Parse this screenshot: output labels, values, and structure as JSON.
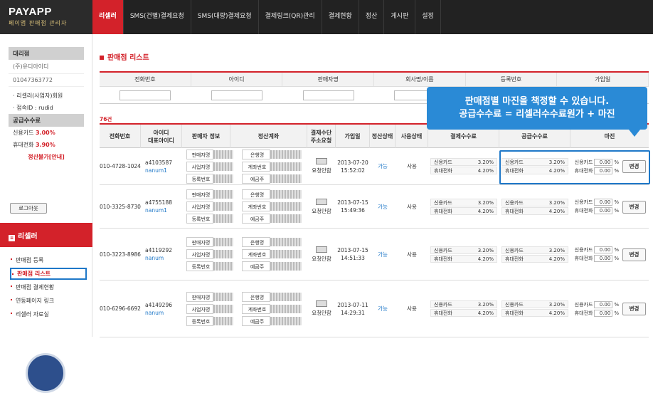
{
  "app": {
    "logo_title": "PAYAPP",
    "logo_subtitle": "페이앱 판매점 관리자"
  },
  "nav": [
    "리셀러",
    "SMS(건별)결제요청",
    "SMS(대량)결제요청",
    "결제링크(QR)관리",
    "결제현황",
    "정산",
    "게시판",
    "설정"
  ],
  "sidebar": {
    "agency_header": "대리점",
    "agency_name": "(주)유디아이디",
    "agency_phone": "01047363772",
    "member_type": "리셀러(사업자)회원",
    "login_label": "접속ID : rudid",
    "fee_header": "공급수수료",
    "card_label": "신용카드",
    "card_value": "3.00%",
    "phone_label": "휴대전화",
    "phone_value": "3.90%",
    "settle_status": "정산불가[안내]",
    "logout_label": "로그아웃",
    "section_title": "리셀러",
    "menu": [
      "판매점 등록",
      "판매점 리스트",
      "판매점 결제현황",
      "연동페이지 링크",
      "리셀러 자료실"
    ]
  },
  "main": {
    "title": "판매점 리스트",
    "search_headers": [
      "전화번호",
      "아이디",
      "판매자명",
      "회사명/이름",
      "등록번호",
      "가입일"
    ],
    "count": "76건",
    "columns": [
      "전화번호",
      "아이디\n대표아이디",
      "판매자 정보",
      "정산계좌",
      "결제수단\n주소요청",
      "가입일",
      "정산상태",
      "사용상태",
      "결제수수료",
      "공급수수료",
      "마진"
    ],
    "seller_labels": [
      "판매자명",
      "사업자명",
      "등록번호"
    ],
    "account_labels": [
      "은행명",
      "계좌번호",
      "예금주"
    ],
    "fee_labels": [
      "신용카드",
      "휴대전화"
    ],
    "change_label": "변경",
    "request_label": "요청안함",
    "rows": [
      {
        "phone": "010-4728-1024",
        "id": "a4103587",
        "rep": "nanum1",
        "joined": [
          "2013-07-20",
          "15:52:02"
        ],
        "settle": "가능",
        "use": "사용",
        "pay_card": "3.20%",
        "pay_phone": "4.20%",
        "sup_card": "3.20%",
        "sup_phone": "4.20%",
        "m_card": "0.00",
        "m_phone": "0.00"
      },
      {
        "phone": "010-3325-8730",
        "id": "a4755188",
        "rep": "nanum1",
        "joined": [
          "2013-07-15",
          "15:49:36"
        ],
        "settle": "가능",
        "use": "사용",
        "pay_card": "3.20%",
        "pay_phone": "4.20%",
        "sup_card": "3.20%",
        "sup_phone": "4.20%",
        "m_card": "0.00",
        "m_phone": "0.00"
      },
      {
        "phone": "010-3223-8986",
        "id": "a4119292",
        "rep": "nanum",
        "joined": [
          "2013-07-15",
          "14:51:33"
        ],
        "settle": "가능",
        "use": "사용",
        "pay_card": "3.20%",
        "pay_phone": "4.20%",
        "sup_card": "3.20%",
        "sup_phone": "4.20%",
        "m_card": "0.00",
        "m_phone": "0.00"
      },
      {
        "phone": "010-6296-6692",
        "id": "a4149296",
        "rep": "nanum",
        "joined": [
          "2013-07-11",
          "14:29:31"
        ],
        "settle": "가능",
        "use": "사용",
        "pay_card": "3.20%",
        "pay_phone": "4.20%",
        "sup_card": "3.20%",
        "sup_phone": "4.20%",
        "m_card": "0.00",
        "m_phone": "0.00"
      }
    ]
  },
  "tooltip": {
    "line1": "판매점별 마진을 책정할 수 있습니다.",
    "line2": "공급수수료 = 리셀러수수료원가 + 마진"
  },
  "colors": {
    "accent": "#d3222a",
    "highlight": "#1f78c8",
    "tooltip": "#2a8ad6"
  }
}
